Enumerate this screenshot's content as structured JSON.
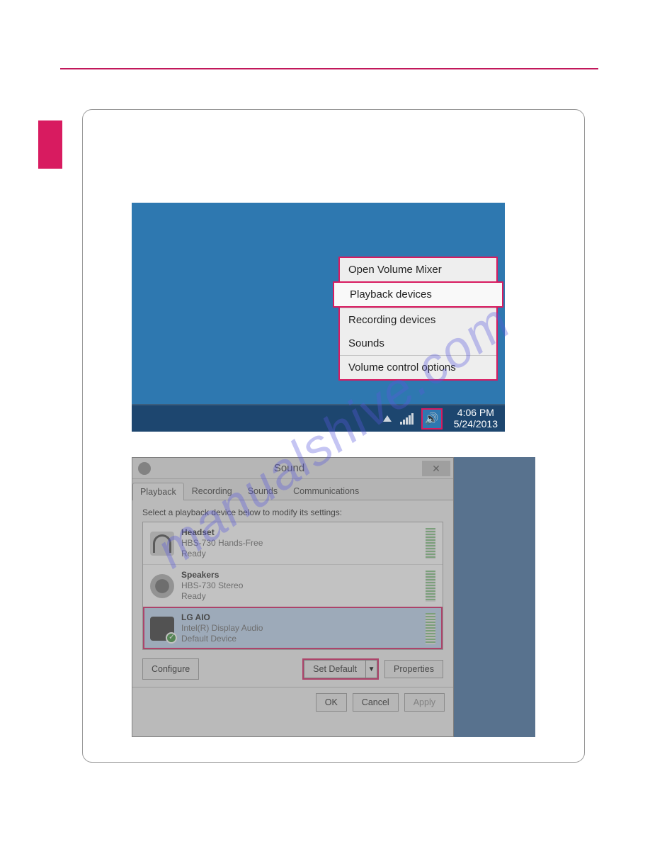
{
  "watermark": "manualshive.com",
  "tray": {
    "time": "4:06 PM",
    "date": "5/24/2013"
  },
  "context_menu": {
    "items": [
      "Open Volume Mixer",
      "Playback devices",
      "Recording devices",
      "Sounds",
      "Volume control options"
    ],
    "highlighted_index": 1
  },
  "sound_dialog": {
    "title": "Sound",
    "tabs": [
      "Playback",
      "Recording",
      "Sounds",
      "Communications"
    ],
    "active_tab_index": 0,
    "instruction": "Select a playback device below to modify its settings:",
    "devices": [
      {
        "name": "Headset",
        "desc": "HBS-730 Hands-Free",
        "status": "Ready",
        "icon": "headset",
        "default": false,
        "selected": false
      },
      {
        "name": "Speakers",
        "desc": "HBS-730 Stereo",
        "status": "Ready",
        "icon": "speaker",
        "default": false,
        "selected": false
      },
      {
        "name": "LG AIO",
        "desc": "Intel(R) Display Audio",
        "status": "Default Device",
        "icon": "monitor",
        "default": true,
        "selected": true
      }
    ],
    "buttons": {
      "configure": "Configure",
      "set_default": "Set Default",
      "properties": "Properties",
      "ok": "OK",
      "cancel": "Cancel",
      "apply": "Apply"
    }
  }
}
